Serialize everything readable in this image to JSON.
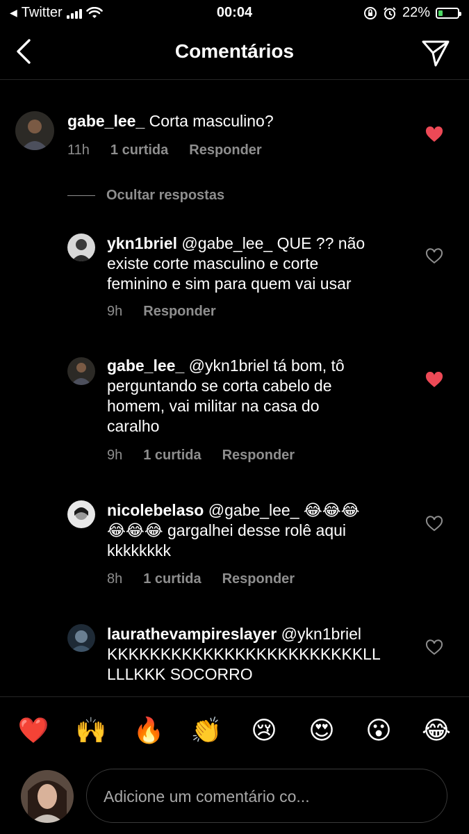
{
  "status_bar": {
    "back_app": "Twitter",
    "time": "00:04",
    "battery_percent": "22%",
    "battery_level": 0.22
  },
  "header": {
    "title": "Comentários"
  },
  "comments": [
    {
      "username": "gabe_lee_",
      "text": "Corta masculino?",
      "time": "11h",
      "likes": "1 curtida",
      "reply": "Responder",
      "liked": true
    }
  ],
  "hide_replies_label": "Ocultar respostas",
  "replies": [
    {
      "username": "ykn1briel",
      "text_lines": [
        "@gabe_lee_ QUE ?? não",
        "existe corte masculino e corte",
        "feminino e sim para quem vai usar"
      ],
      "time": "9h",
      "reply": "Responder",
      "liked": false
    },
    {
      "username": "gabe_lee_",
      "text_lines": [
        "@ykn1briel tá bom, tô",
        "perguntando se corta cabelo de",
        "homem, vai militar na casa do",
        "caralho"
      ],
      "time": "9h",
      "likes": "1 curtida",
      "reply": "Responder",
      "liked": true
    },
    {
      "username": "nicolebelaso",
      "text_lines": [
        "@gabe_lee_ 😂😂😂",
        "😂😂😂 gargalhei desse rolê aqui",
        "kkkkkkkk"
      ],
      "time": "8h",
      "likes": "1 curtida",
      "reply": "Responder",
      "liked": false
    },
    {
      "username": "laurathevampireslayer",
      "text_lines": [
        "@ykn1briel",
        "KKKKKKKKKKKKKKKKKKKKKKKKLL",
        "LLLKKK SOCORRO"
      ],
      "liked": false
    }
  ],
  "emoji_bar": [
    "❤️",
    "🙌",
    "🔥",
    "👏",
    "😢",
    "😍",
    "😮",
    "😂"
  ],
  "comment_input": {
    "placeholder": "Adicione um comentário co..."
  },
  "colors": {
    "background": "#000000",
    "secondary_text": "#8e8e8e",
    "like_red": "#ed4956",
    "divider": "#262626"
  }
}
